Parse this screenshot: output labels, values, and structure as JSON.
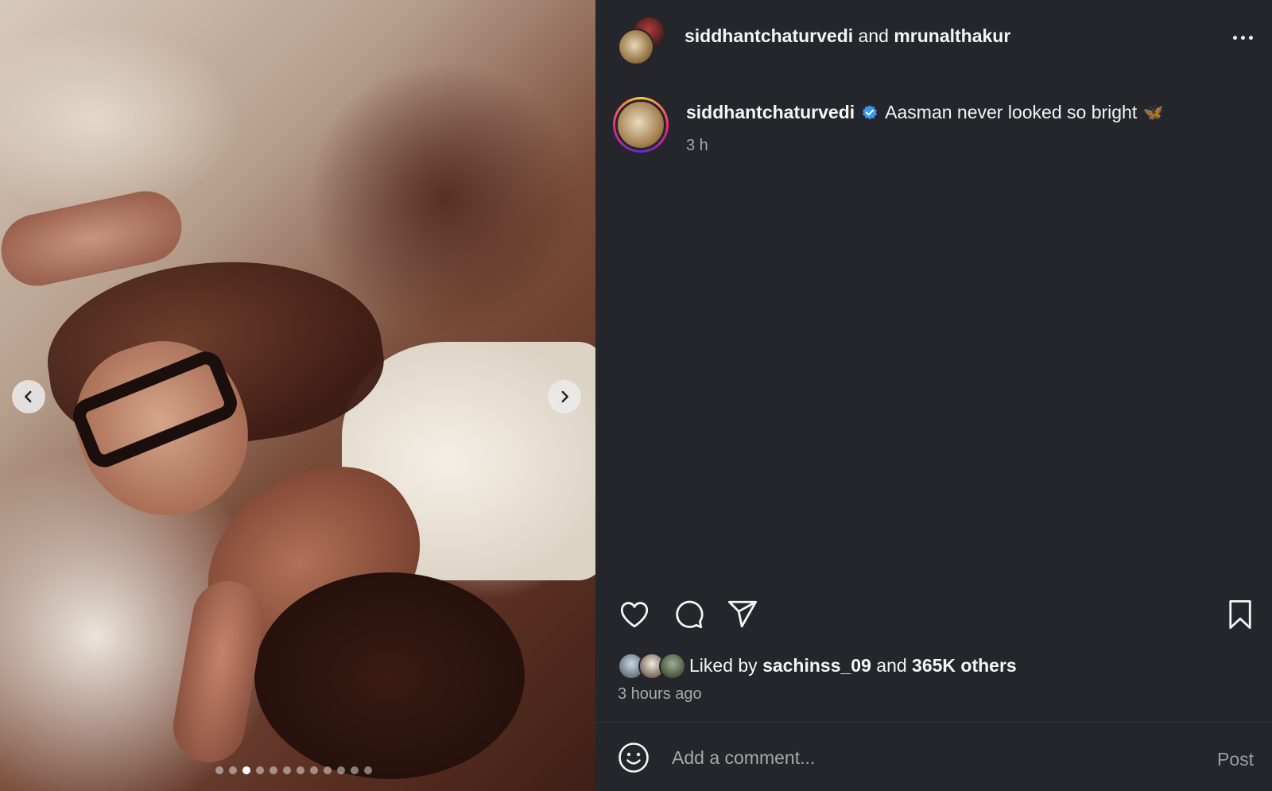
{
  "carousel": {
    "slide_count": 12,
    "active_index": 2
  },
  "header": {
    "author": "siddhantchaturvedi",
    "joiner": "and",
    "collaborator": "mrunalthakur"
  },
  "caption": {
    "username": "siddhantchaturvedi",
    "text": "Aasman never looked so bright",
    "emoji": "🦋",
    "time": "3 h"
  },
  "likes": {
    "prefix": "Liked by",
    "liker": "sachinss_09",
    "joiner": "and",
    "others": "365K others",
    "time": "3 hours ago"
  },
  "comment": {
    "placeholder": "Add a comment...",
    "post_label": "Post"
  },
  "colors": {
    "background": "#25262b",
    "verified_badge": "#3897f0",
    "muted_text": "#a8a8a8"
  },
  "icons": [
    "chevron-left-icon",
    "chevron-right-icon",
    "more-icon",
    "verified-icon",
    "heart-icon",
    "comment-icon",
    "share-icon",
    "bookmark-icon",
    "emoji-icon"
  ]
}
